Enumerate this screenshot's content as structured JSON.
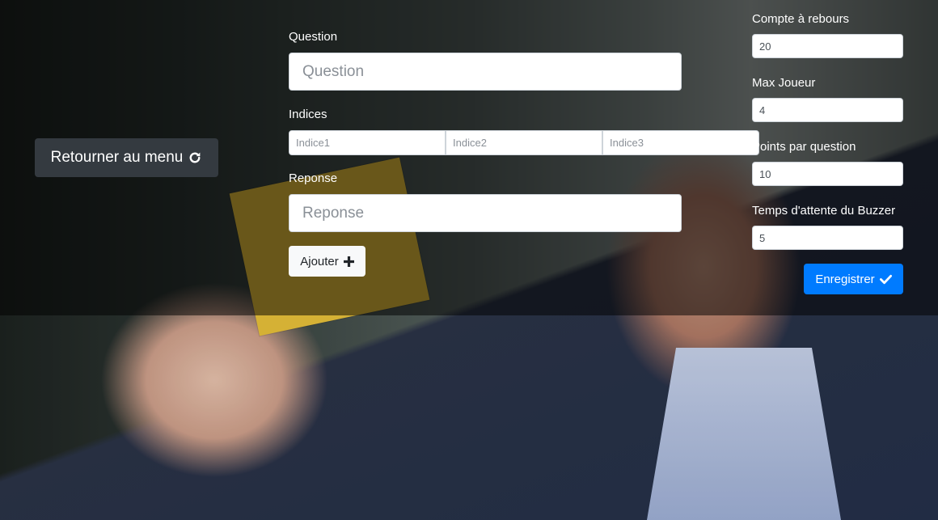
{
  "back_button": {
    "label": "Retourner au menu",
    "icon": "refresh-icon"
  },
  "question": {
    "label": "Question",
    "placeholder": "Question"
  },
  "hints": {
    "label": "Indices",
    "fields": [
      {
        "placeholder": "Indice1"
      },
      {
        "placeholder": "Indice2"
      },
      {
        "placeholder": "Indice3"
      }
    ]
  },
  "answer": {
    "label": "Reponse",
    "placeholder": "Reponse"
  },
  "add_button": {
    "label": "Ajouter",
    "icon": "plus-icon"
  },
  "settings": {
    "countdown": {
      "label": "Compte à rebours",
      "value": "20"
    },
    "max_players": {
      "label": "Max Joueur",
      "value": "4"
    },
    "points": {
      "label": "Points par question",
      "value": "10"
    },
    "buzzer_wait": {
      "label": "Temps d'attente du Buzzer",
      "value": "5"
    }
  },
  "save_button": {
    "label": "Enregistrer",
    "icon": "check-icon"
  },
  "colors": {
    "primary": "#007bff",
    "dark": "#343a40",
    "light": "#f8f9fa"
  }
}
